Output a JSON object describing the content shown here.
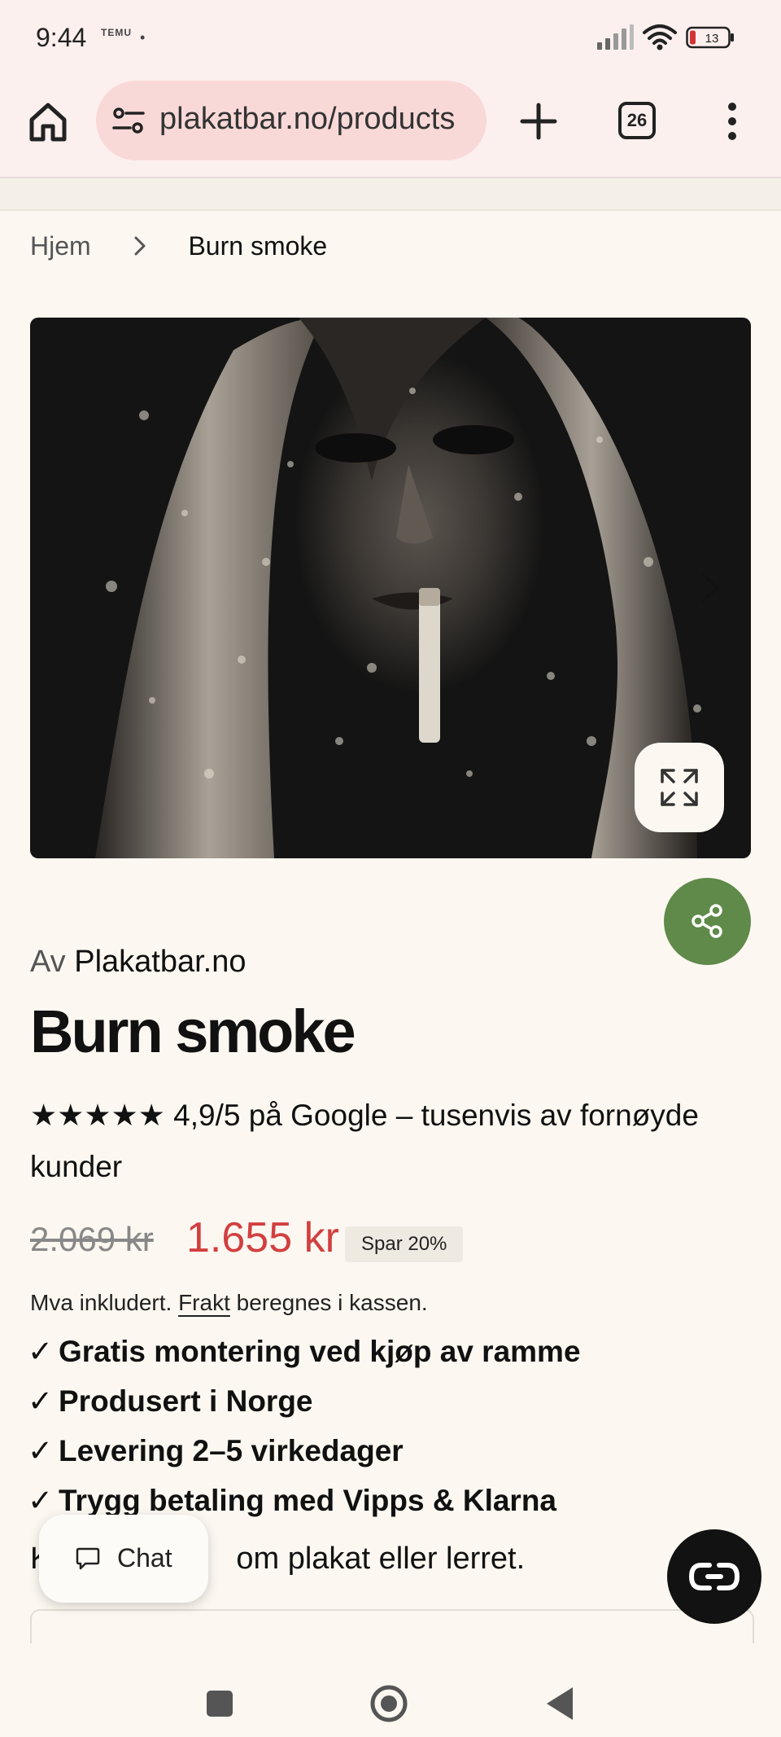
{
  "status_bar": {
    "time": "9:44",
    "notification_app": "TEMU",
    "battery_level": "13",
    "battery_color": "#d23333"
  },
  "browser": {
    "url": "plakatbar.no/products",
    "tab_count": "26",
    "home_icon": "home-icon",
    "site_info_icon": "site-settings-icon",
    "new_tab_icon": "plus-icon",
    "menu_icon": "more-vertical-icon"
  },
  "breadcrumb": {
    "home": "Hjem",
    "separator_icon": "chevron-right-icon",
    "current": "Burn smoke"
  },
  "product": {
    "image_alt": "Burn smoke",
    "vendor_prefix": "Av",
    "vendor_name": "Plakatbar.no",
    "title": "Burn smoke",
    "rating_text": "★★★★★ 4,9/5 på Google – tusenvis av fornøyde kunder",
    "compare_price": "2.069 kr",
    "sale_price": "1.655 kr",
    "save_badge": "Spar 20%",
    "tax_note_before": "Mva inkludert.",
    "tax_note_link": "Frakt",
    "tax_note_after": "beregnes i kassen.",
    "features": [
      "Gratis montering ved kjøp av ramme",
      "Produsert i Norge",
      "Levering 2–5 virkedager",
      "Trygg betaling med Vipps & Klarna"
    ],
    "check_symbol": "✓",
    "partial_text_start": "K",
    "partial_text_end": "om plakat eller lerret.",
    "accent_sale_color": "#d23f3f",
    "share_color": "#5f8a4a"
  },
  "chat": {
    "label": "Chat",
    "icon": "chat-bubble-icon"
  },
  "fab": {
    "icon": "link-icon"
  },
  "nav": {
    "recent_icon": "square-icon",
    "home_icon": "circle-icon",
    "back_icon": "triangle-back-icon"
  }
}
